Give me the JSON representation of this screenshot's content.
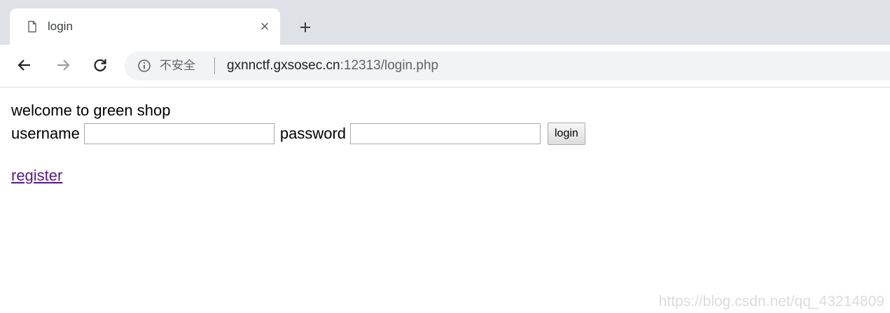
{
  "browser": {
    "tab": {
      "title": "login",
      "close_glyph": "×",
      "favicon": "page-icon"
    },
    "new_tab_glyph": "+",
    "nav": {
      "back": "back-arrow-icon",
      "forward": "forward-arrow-icon",
      "reload": "reload-icon"
    },
    "omnibox": {
      "security_label": "不安全",
      "url_host": "gxnnctf.gxsosec.cn",
      "url_rest": ":12313/login.php"
    }
  },
  "page": {
    "welcome_text": "welcome to green shop",
    "username_label": "username",
    "username_value": "",
    "password_label": "password",
    "password_value": "",
    "login_button": "login",
    "register_link": "register"
  },
  "watermark": "https://blog.csdn.net/qq_43214809",
  "colors": {
    "tabstrip": "#dee1e6",
    "omnibox": "#f1f3f4",
    "visited_link": "#551a8b"
  }
}
